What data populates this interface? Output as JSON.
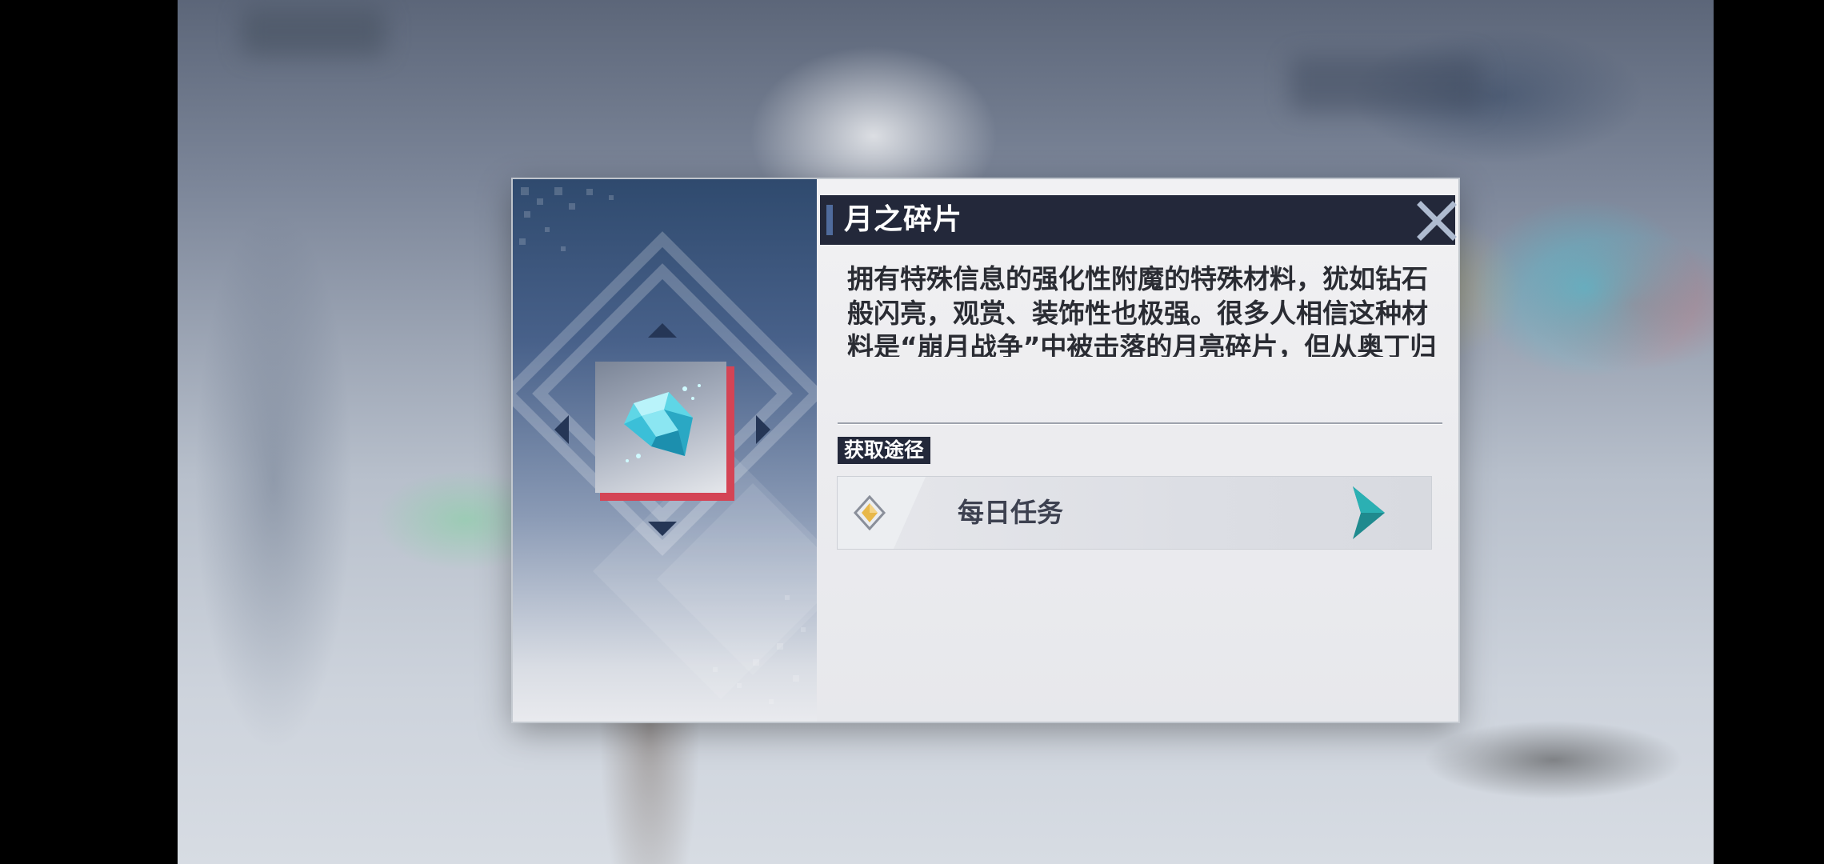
{
  "item": {
    "name": "月之碎片",
    "description": "拥有特殊信息的强化性附魔的特殊材料，犹如钻石般闪亮，观赏、装饰性也极强。很多人相信这种材料是“崩月战争”中被击落的月亮碎片，但从奥丁归隐后，这种结晶就在阿斯加德已变得越来越稀少，目前仅能通过特殊渠道获得。",
    "icon": "moon-shard-crystal-icon"
  },
  "sources": {
    "label": "获取途径",
    "items": [
      {
        "label": "每日任务",
        "icon": "diamond-icon",
        "action_icon": "chevron-right-icon"
      }
    ]
  },
  "colors": {
    "title_bar": "#23283a",
    "item_rarity_accent": "#d44455",
    "crystal": "#5fd6e6",
    "source_arrow": "#1f8a8e",
    "source_diamond": "#e8b84a"
  }
}
